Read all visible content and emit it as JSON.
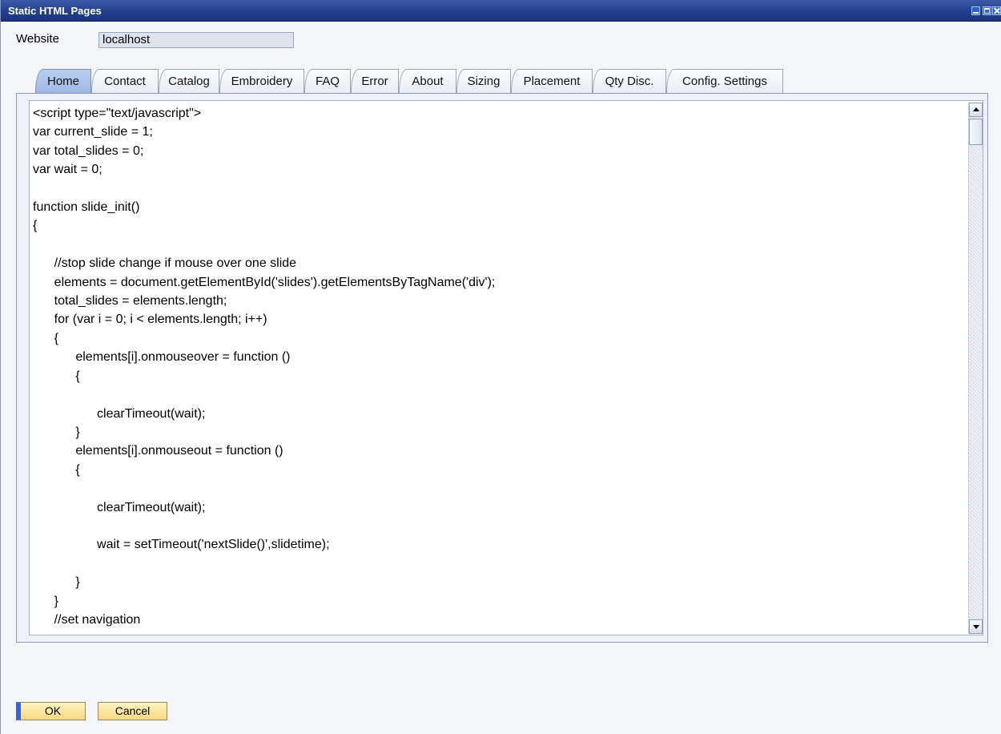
{
  "window": {
    "title": "Static HTML Pages"
  },
  "form": {
    "website_label": "Website",
    "website_value": "localhost"
  },
  "tabs": [
    {
      "label": "Home",
      "active": true
    },
    {
      "label": "Contact",
      "active": false
    },
    {
      "label": "Catalog",
      "active": false
    },
    {
      "label": "Embroidery",
      "active": false
    },
    {
      "label": "FAQ",
      "active": false
    },
    {
      "label": "Error",
      "active": false
    },
    {
      "label": "About",
      "active": false
    },
    {
      "label": "Sizing",
      "active": false
    },
    {
      "label": "Placement",
      "active": false
    },
    {
      "label": "Qty Disc.",
      "active": false
    },
    {
      "label": "Config. Settings",
      "active": false
    }
  ],
  "editor": {
    "code": "<script type=\"text/javascript\">\nvar current_slide = 1;\nvar total_slides = 0;\nvar wait = 0;\n\nfunction slide_init()\n{\n\n      //stop slide change if mouse over one slide\n      elements = document.getElementById('slides').getElementsByTagName('div');\n      total_slides = elements.length;\n      for (var i = 0; i < elements.length; i++)\n      {\n            elements[i].onmouseover = function ()\n            {\n\n                  clearTimeout(wait);\n            }\n            elements[i].onmouseout = function ()\n            {\n\n                  clearTimeout(wait);\n\n                  wait = setTimeout('nextSlide()',slidetime);\n\n            }\n      }\n      //set navigation"
  },
  "buttons": {
    "ok_label": "OK",
    "cancel_label": "Cancel"
  },
  "colors": {
    "titlebar": "#22408f",
    "active_tab": "#9fb8e4",
    "button_face": "#f9d97f",
    "ok_accent": "#3d63c8"
  }
}
